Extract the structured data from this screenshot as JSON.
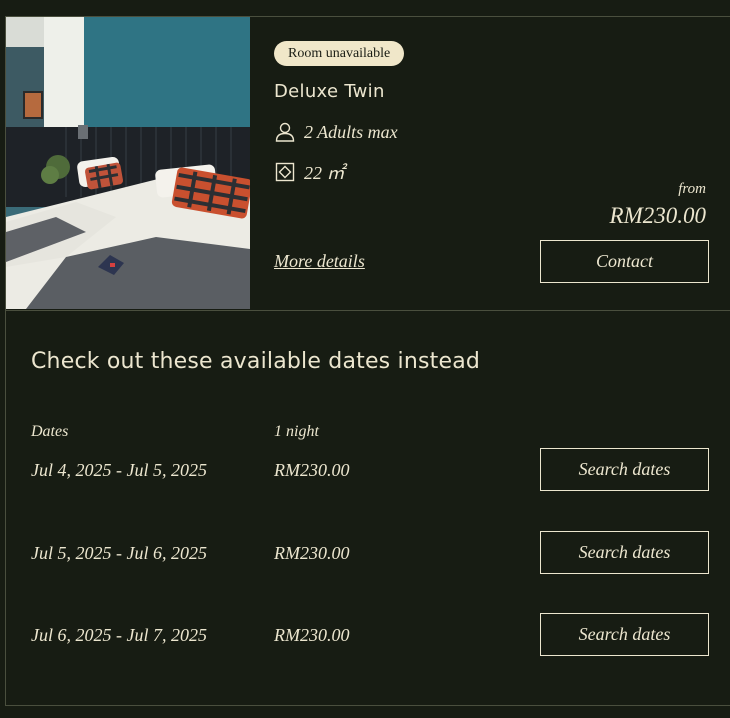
{
  "room": {
    "status_badge": "Room unavailable",
    "name": "Deluxe Twin",
    "occupancy": "2 Adults max",
    "size": "22 ㎡",
    "icons": {
      "occupancy": "person-icon",
      "size": "room-size-icon"
    },
    "from_label": "from",
    "price": "RM230.00",
    "more_details_label": "More details",
    "contact_label": "Contact"
  },
  "alternatives": {
    "heading": "Check out these available dates instead",
    "column_dates": "Dates",
    "column_nights": "1 night",
    "rows": [
      {
        "dates": "Jul 4, 2025 - Jul 5, 2025",
        "price": "RM230.00",
        "button": "Search dates"
      },
      {
        "dates": "Jul 5, 2025 - Jul 6, 2025",
        "price": "RM230.00",
        "button": "Search dates"
      },
      {
        "dates": "Jul 6, 2025 - Jul 7, 2025",
        "price": "RM230.00",
        "button": "Search dates"
      }
    ]
  },
  "colors": {
    "background": "#171c13",
    "text": "#ece6cf",
    "badge_bg": "#f0e7c9",
    "border": "#4a4f3e"
  }
}
